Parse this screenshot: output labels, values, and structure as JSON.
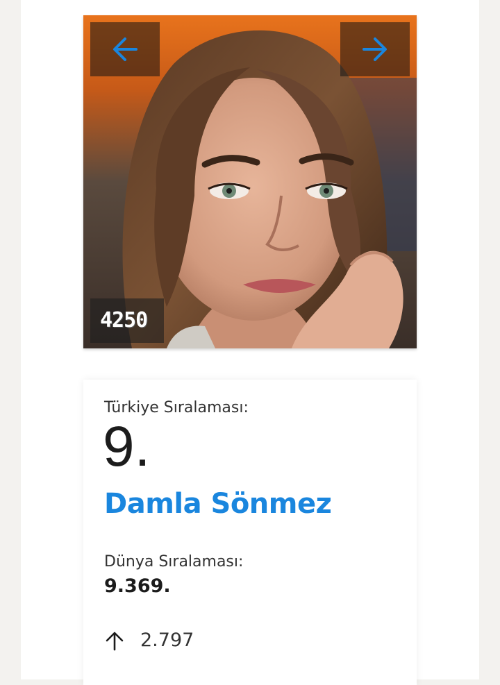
{
  "photo": {
    "alt": "Damla Sönmez",
    "score_badge": "4250",
    "prev_icon": "arrow-left-icon",
    "next_icon": "arrow-right-icon"
  },
  "card": {
    "turkey_rank_label": "Türkiye Sıralaması:",
    "turkey_rank": "9.",
    "player_name": "Damla Sönmez",
    "world_rank_label": "Dünya Sıralaması:",
    "world_rank": "9.369.",
    "change_icon": "arrow-up-icon",
    "change_value": "2.797"
  },
  "colors": {
    "accent": "#1a86de",
    "text_dark": "#1c1c1c",
    "page_bg": "#f3f2ef"
  }
}
